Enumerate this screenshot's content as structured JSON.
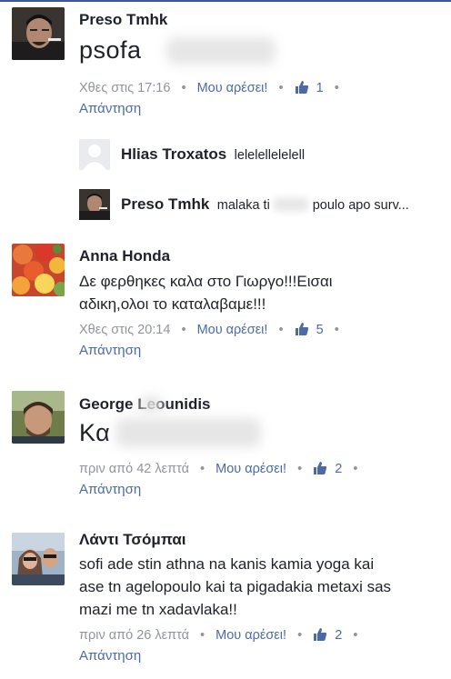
{
  "comments": [
    {
      "author": "Preso Tmhk",
      "text": "psofa",
      "time": "Χθες στις 17:16",
      "like_label": "Μου αρέσει!",
      "like_count": "1",
      "reply_label": "Απάντηση"
    },
    {
      "author": "Anna Honda",
      "text_line1": "Δε φερθηκες καλα στο Γιωργο!!!Εισαι",
      "text_line2": "αδικη,ολοι το καταλαβαμε!!!",
      "time": "Χθες στις 20:14",
      "like_label": "Μου αρέσει!",
      "like_count": "5",
      "reply_label": "Απάντηση"
    },
    {
      "author": "George Leounidis",
      "text": "Κα",
      "time": "πριν από 42 λεπτά",
      "like_label": "Μου αρέσει!",
      "like_count": "2",
      "reply_label": "Απάντηση"
    },
    {
      "author": "Λάντι Τσόμπαι",
      "text_line1": "sofi ade stin athna na kanis kamia yoga kai",
      "text_line2": "ase tn agelopoulo kai ta pigadakia metaxi sas",
      "text_line3": "mazi me tn xadavlaka!!",
      "time": "πριν από 26 λεπτά",
      "like_label": "Μου αρέσει!",
      "like_count": "2",
      "reply_label": "Απάντηση"
    }
  ],
  "replies": [
    {
      "author": "Hlias Troxatos",
      "text": "lelelellelelell"
    },
    {
      "author": "Preso Tmhk",
      "text_pre": "malaka ti",
      "text_post": "poulo apo surv..."
    }
  ],
  "dot": "•",
  "colors": {
    "link": "#4b6aa6",
    "meta": "#90949c",
    "text": "#1d2129"
  }
}
